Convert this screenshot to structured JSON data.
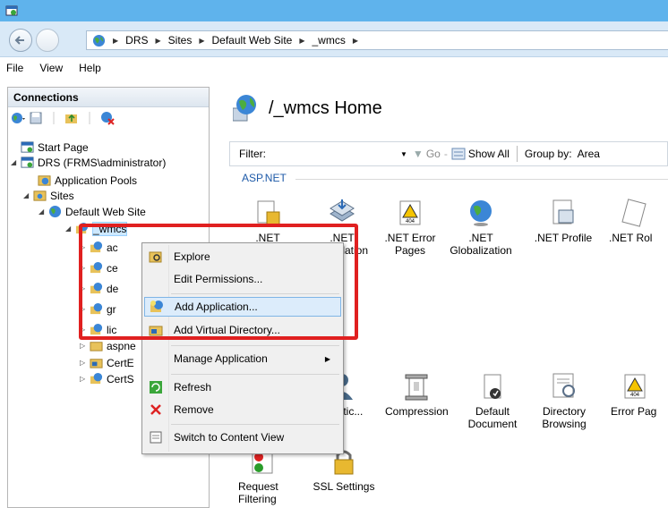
{
  "address": {
    "crumbs": [
      "DRS",
      "Sites",
      "Default Web Site",
      "_wmcs"
    ]
  },
  "menu": {
    "file": "File",
    "view": "View",
    "help": "Help"
  },
  "connections": {
    "header": "Connections",
    "tree": {
      "start_page": "Start Page",
      "server": "DRS (FRMS\\administrator)",
      "app_pools": "Application Pools",
      "sites": "Sites",
      "default_site": "Default Web Site",
      "selected": "_wmcs",
      "child_prefixes": [
        "ac",
        "ce",
        "de",
        "gr",
        "lic"
      ],
      "aspnet": "aspne",
      "certe": "CertE",
      "certs": "CertS"
    }
  },
  "home": {
    "title": "/_wmcs Home",
    "filter_label": "Filter:",
    "go_label": "Go",
    "show_all_label": "Show All",
    "group_by_label": "Group by:",
    "group_by_value": "Area",
    "group_aspnet": "ASP.NET",
    "features_row1": [
      ".NET",
      ".NET",
      ".NET Error Pages",
      ".NET Globalization",
      ".NET Profile",
      ".NET Rol"
    ],
    "feature_row1_b_extra": "pilation",
    "features_row2": [
      "entic...",
      "Compression",
      "Default Document",
      "Directory Browsing",
      "Error Pag"
    ],
    "features_row3": [
      "Request Filtering",
      "SSL Settings"
    ]
  },
  "context_menu": {
    "items": {
      "explore": "Explore",
      "edit_permissions": "Edit Permissions...",
      "add_application": "Add Application...",
      "add_virtual_directory": "Add Virtual Directory...",
      "manage_application": "Manage Application",
      "refresh": "Refresh",
      "remove": "Remove",
      "switch_content_view": "Switch to Content View"
    }
  },
  "colors": {
    "title_bar": "#5fb3ec",
    "highlight_box": "#e02020",
    "hover_item": "#dcecfb",
    "group_header": "#1e5aa8"
  }
}
